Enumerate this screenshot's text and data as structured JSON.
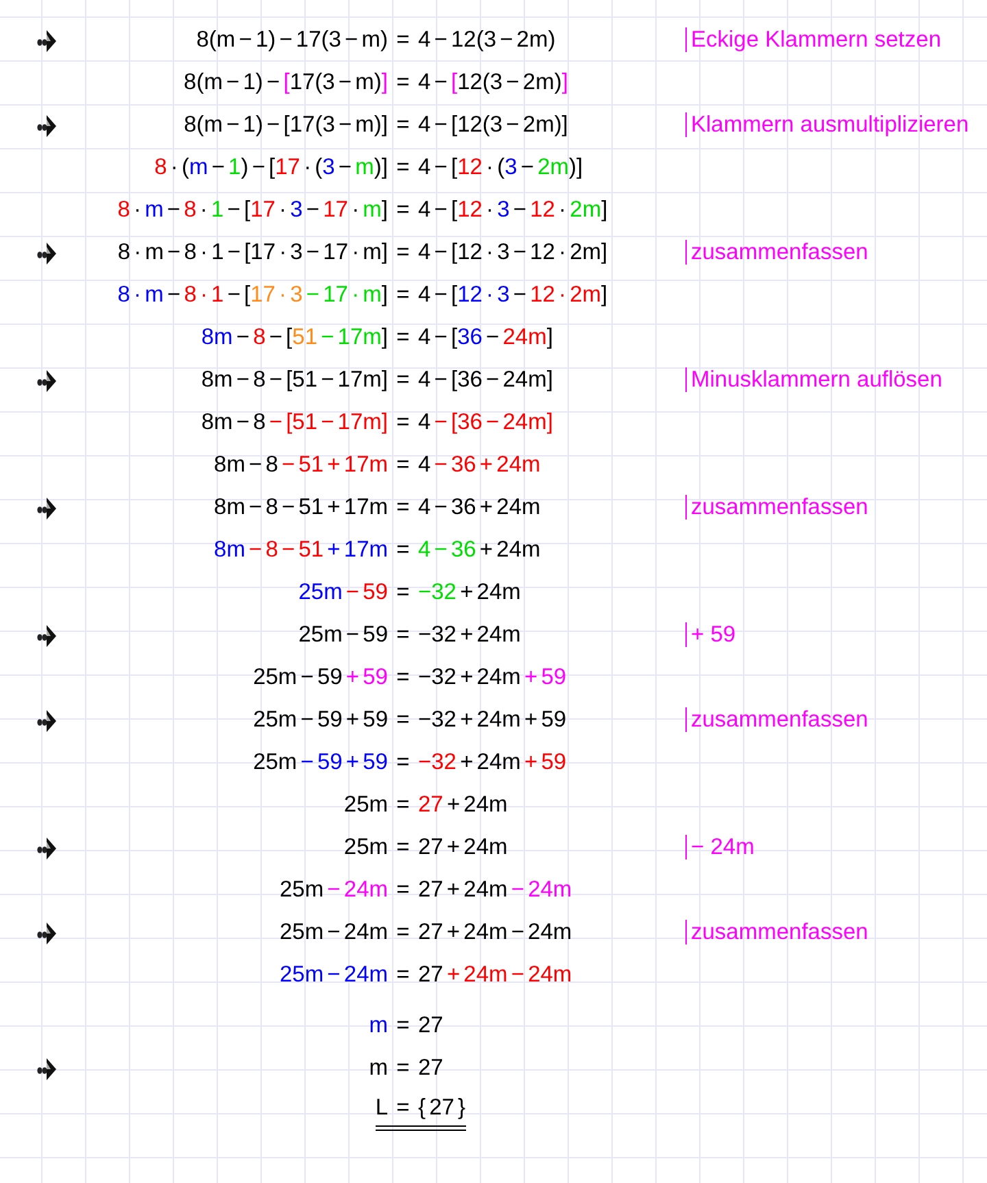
{
  "rows": [
    {
      "kind": "equation",
      "marker": true,
      "lhs": [
        {
          "t": "8(m − 1) − 17(3 − m)",
          "color": "#000000"
        }
      ],
      "relation": "=",
      "rhs": [
        {
          "t": "4 − 12(3 − 2m)",
          "color": "#000000"
        }
      ],
      "note": "Eckige Klammern setzen"
    },
    {
      "kind": "equation",
      "marker": false,
      "lhs": [
        {
          "t": "8(m − 1) − ",
          "color": "#000000"
        },
        {
          "t": "[",
          "color": "#ff00ff"
        },
        {
          "t": "17(3 − m)",
          "color": "#000000"
        },
        {
          "t": "]",
          "color": "#ff00ff"
        }
      ],
      "relation": "=",
      "rhs": [
        {
          "t": "4 − ",
          "color": "#000000"
        },
        {
          "t": "[",
          "color": "#ff00ff"
        },
        {
          "t": "12(3 − 2m)",
          "color": "#000000"
        },
        {
          "t": "]",
          "color": "#ff00ff"
        }
      ]
    },
    {
      "kind": "equation",
      "marker": true,
      "lhs": [
        {
          "t": "8(m − 1) − [17(3 − m)]",
          "color": "#000000"
        }
      ],
      "relation": "=",
      "rhs": [
        {
          "t": "4 − [12(3 − 2m)]",
          "color": "#000000"
        }
      ],
      "note": "Klammern ausmultiplizieren"
    },
    {
      "kind": "equation",
      "marker": false,
      "lhs": [
        {
          "t": "8",
          "color": "#ff0000"
        },
        {
          "t": " · (",
          "color": "#000000"
        },
        {
          "t": "m",
          "color": "#0000ff"
        },
        {
          "t": " − ",
          "color": "#000000"
        },
        {
          "t": "1",
          "color": "#00dd00"
        },
        {
          "t": ") − [",
          "color": "#000000"
        },
        {
          "t": "17",
          "color": "#ff0000"
        },
        {
          "t": " · (",
          "color": "#000000"
        },
        {
          "t": "3",
          "color": "#0000ff"
        },
        {
          "t": " − ",
          "color": "#000000"
        },
        {
          "t": "m",
          "color": "#00dd00"
        },
        {
          "t": ")]",
          "color": "#000000"
        }
      ],
      "relation": "=",
      "rhs": [
        {
          "t": "4 − [",
          "color": "#000000"
        },
        {
          "t": "12",
          "color": "#ff0000"
        },
        {
          "t": " · (",
          "color": "#000000"
        },
        {
          "t": "3",
          "color": "#0000ff"
        },
        {
          "t": " − ",
          "color": "#000000"
        },
        {
          "t": "2m",
          "color": "#00dd00"
        },
        {
          "t": ")]",
          "color": "#000000"
        }
      ]
    },
    {
      "kind": "equation",
      "marker": false,
      "lhs": [
        {
          "t": "8",
          "color": "#ff0000"
        },
        {
          "t": " · ",
          "color": "#000000"
        },
        {
          "t": "m",
          "color": "#0000ff"
        },
        {
          "t": " − ",
          "color": "#000000"
        },
        {
          "t": "8",
          "color": "#ff0000"
        },
        {
          "t": " · ",
          "color": "#000000"
        },
        {
          "t": "1",
          "color": "#00dd00"
        },
        {
          "t": " − [",
          "color": "#000000"
        },
        {
          "t": "17",
          "color": "#ff0000"
        },
        {
          "t": " · ",
          "color": "#000000"
        },
        {
          "t": "3",
          "color": "#0000ff"
        },
        {
          "t": " − ",
          "color": "#000000"
        },
        {
          "t": "17",
          "color": "#ff0000"
        },
        {
          "t": " · ",
          "color": "#000000"
        },
        {
          "t": "m",
          "color": "#00dd00"
        },
        {
          "t": "]",
          "color": "#000000"
        }
      ],
      "relation": "=",
      "rhs": [
        {
          "t": "4 − [",
          "color": "#000000"
        },
        {
          "t": "12",
          "color": "#ff0000"
        },
        {
          "t": " · ",
          "color": "#000000"
        },
        {
          "t": "3",
          "color": "#0000ff"
        },
        {
          "t": " − ",
          "color": "#000000"
        },
        {
          "t": "12",
          "color": "#ff0000"
        },
        {
          "t": " · ",
          "color": "#000000"
        },
        {
          "t": "2m",
          "color": "#00dd00"
        },
        {
          "t": "]",
          "color": "#000000"
        }
      ]
    },
    {
      "kind": "equation",
      "marker": true,
      "lhs": [
        {
          "t": "8 · m − 8 · 1 − [17 · 3 − 17 · m]",
          "color": "#000000"
        }
      ],
      "relation": "=",
      "rhs": [
        {
          "t": "4 − [12 · 3 − 12 · 2m]",
          "color": "#000000"
        }
      ],
      "note": "zusammenfassen"
    },
    {
      "kind": "equation",
      "marker": false,
      "lhs": [
        {
          "t": "8 · m",
          "color": "#0000ff"
        },
        {
          "t": " − ",
          "color": "#000000"
        },
        {
          "t": "8 · 1",
          "color": "#ff0000"
        },
        {
          "t": " − [",
          "color": "#000000"
        },
        {
          "t": "17 · 3",
          "color": "#ff8c1a"
        },
        {
          "t": " − 17 · m",
          "color": "#00dd00"
        },
        {
          "t": "]",
          "color": "#000000"
        }
      ],
      "relation": "=",
      "rhs": [
        {
          "t": "4 − [",
          "color": "#000000"
        },
        {
          "t": "12 · 3",
          "color": "#0000ff"
        },
        {
          "t": " − ",
          "color": "#000000"
        },
        {
          "t": "12 · 2m",
          "color": "#ff0000"
        },
        {
          "t": "]",
          "color": "#000000"
        }
      ]
    },
    {
      "kind": "equation",
      "marker": false,
      "lhs": [
        {
          "t": "8m",
          "color": "#0000ff"
        },
        {
          "t": " − ",
          "color": "#000000"
        },
        {
          "t": "8",
          "color": "#ff0000"
        },
        {
          "t": " − [",
          "color": "#000000"
        },
        {
          "t": "51",
          "color": "#ff8c1a"
        },
        {
          "t": " − 17m",
          "color": "#00dd00"
        },
        {
          "t": "]",
          "color": "#000000"
        }
      ],
      "relation": "=",
      "rhs": [
        {
          "t": "4 − [",
          "color": "#000000"
        },
        {
          "t": "36",
          "color": "#0000ff"
        },
        {
          "t": " − ",
          "color": "#000000"
        },
        {
          "t": "24m",
          "color": "#ff0000"
        },
        {
          "t": "]",
          "color": "#000000"
        }
      ]
    },
    {
      "kind": "equation",
      "marker": true,
      "lhs": [
        {
          "t": "8m − 8 − [51 − 17m]",
          "color": "#000000"
        }
      ],
      "relation": "=",
      "rhs": [
        {
          "t": "4 − [36 − 24m]",
          "color": "#000000"
        }
      ],
      "note": "Minusklammern auflösen"
    },
    {
      "kind": "equation",
      "marker": false,
      "lhs": [
        {
          "t": "8m − 8 ",
          "color": "#000000"
        },
        {
          "t": "− [51 − 17m]",
          "color": "#ff0000"
        }
      ],
      "relation": "=",
      "rhs": [
        {
          "t": "4 ",
          "color": "#000000"
        },
        {
          "t": "− [36 − 24m]",
          "color": "#ff0000"
        }
      ]
    },
    {
      "kind": "equation",
      "marker": false,
      "lhs": [
        {
          "t": "8m − 8 ",
          "color": "#000000"
        },
        {
          "t": "− 51 + 17m",
          "color": "#ff0000"
        }
      ],
      "relation": "=",
      "rhs": [
        {
          "t": "4 ",
          "color": "#000000"
        },
        {
          "t": "− 36 + 24m",
          "color": "#ff0000"
        }
      ]
    },
    {
      "kind": "equation",
      "marker": true,
      "lhs": [
        {
          "t": "8m − 8 − 51 + 17m",
          "color": "#000000"
        }
      ],
      "relation": "=",
      "rhs": [
        {
          "t": "4 − 36 + 24m",
          "color": "#000000"
        }
      ],
      "note": "zusammenfassen"
    },
    {
      "kind": "equation",
      "marker": false,
      "lhs": [
        {
          "t": "8m",
          "color": "#0000ff"
        },
        {
          "t": " − 8 − 51",
          "color": "#ff0000"
        },
        {
          "t": " + 17m",
          "color": "#0000ff"
        }
      ],
      "relation": "=",
      "rhs": [
        {
          "t": "4 − 36",
          "color": "#00dd00"
        },
        {
          "t": " + 24m",
          "color": "#000000"
        }
      ]
    },
    {
      "kind": "equation",
      "marker": false,
      "lhs": [
        {
          "t": "25m",
          "color": "#0000ff"
        },
        {
          "t": " − 59",
          "color": "#ff0000"
        }
      ],
      "relation": "=",
      "rhs": [
        {
          "t": "−32",
          "color": "#00dd00"
        },
        {
          "t": " + 24m",
          "color": "#000000"
        }
      ]
    },
    {
      "kind": "equation",
      "marker": true,
      "lhs": [
        {
          "t": "25m − 59",
          "color": "#000000"
        }
      ],
      "relation": "=",
      "rhs": [
        {
          "t": "−32 + 24m",
          "color": "#000000"
        }
      ],
      "note": "+ 59"
    },
    {
      "kind": "equation",
      "marker": false,
      "lhs": [
        {
          "t": "25m − 59",
          "color": "#000000"
        },
        {
          "t": " + 59",
          "color": "#ff00ff"
        }
      ],
      "relation": "=",
      "rhs": [
        {
          "t": "−32 + 24m",
          "color": "#000000"
        },
        {
          "t": " + 59",
          "color": "#ff00ff"
        }
      ]
    },
    {
      "kind": "equation",
      "marker": true,
      "lhs": [
        {
          "t": "25m − 59 + 59",
          "color": "#000000"
        }
      ],
      "relation": "=",
      "rhs": [
        {
          "t": "−32 + 24m + 59",
          "color": "#000000"
        }
      ],
      "note": "zusammenfassen"
    },
    {
      "kind": "equation",
      "marker": false,
      "lhs": [
        {
          "t": "25m",
          "color": "#000000"
        },
        {
          "t": " − 59 + 59",
          "color": "#0000ff"
        }
      ],
      "relation": "=",
      "rhs": [
        {
          "t": "−32",
          "color": "#ff0000"
        },
        {
          "t": " + 24m",
          "color": "#000000"
        },
        {
          "t": " + 59",
          "color": "#ff0000"
        }
      ]
    },
    {
      "kind": "equation",
      "marker": false,
      "lhs": [
        {
          "t": "25m",
          "color": "#000000"
        }
      ],
      "relation": "=",
      "rhs": [
        {
          "t": "27",
          "color": "#ff0000"
        },
        {
          "t": " + 24m",
          "color": "#000000"
        }
      ]
    },
    {
      "kind": "equation",
      "marker": true,
      "lhs": [
        {
          "t": "25m",
          "color": "#000000"
        }
      ],
      "relation": "=",
      "rhs": [
        {
          "t": "27 + 24m",
          "color": "#000000"
        }
      ],
      "note": "− 24m"
    },
    {
      "kind": "equation",
      "marker": false,
      "lhs": [
        {
          "t": "25m",
          "color": "#000000"
        },
        {
          "t": " − 24m",
          "color": "#ff00ff"
        }
      ],
      "relation": "=",
      "rhs": [
        {
          "t": "27 + 24m",
          "color": "#000000"
        },
        {
          "t": " − 24m",
          "color": "#ff00ff"
        }
      ]
    },
    {
      "kind": "equation",
      "marker": true,
      "lhs": [
        {
          "t": "25m − 24m",
          "color": "#000000"
        }
      ],
      "relation": "=",
      "rhs": [
        {
          "t": "27 + 24m − 24m",
          "color": "#000000"
        }
      ],
      "note": "zusammenfassen"
    },
    {
      "kind": "equation",
      "marker": false,
      "lhs": [
        {
          "t": "25m − 24m",
          "color": "#0000ff"
        }
      ],
      "relation": "=",
      "rhs": [
        {
          "t": "27",
          "color": "#000000"
        },
        {
          "t": " + 24m − 24m",
          "color": "#ff0000"
        }
      ]
    },
    {
      "kind": "equation",
      "marker": false,
      "lhs": [
        {
          "t": "m",
          "color": "#0000ff"
        }
      ],
      "relation": "=",
      "rhs": [
        {
          "t": "27",
          "color": "#000000"
        }
      ]
    },
    {
      "kind": "equation",
      "marker": true,
      "lhs": [
        {
          "t": "m",
          "color": "#000000"
        }
      ],
      "relation": "=",
      "rhs": [
        {
          "t": "27",
          "color": "#000000"
        }
      ]
    },
    {
      "kind": "result",
      "marker": false,
      "lhs": [
        {
          "t": "L",
          "color": "#000000"
        }
      ],
      "relation": "=",
      "rhs": [
        {
          "t": "{ 27 }",
          "color": "#000000"
        }
      ]
    }
  ]
}
